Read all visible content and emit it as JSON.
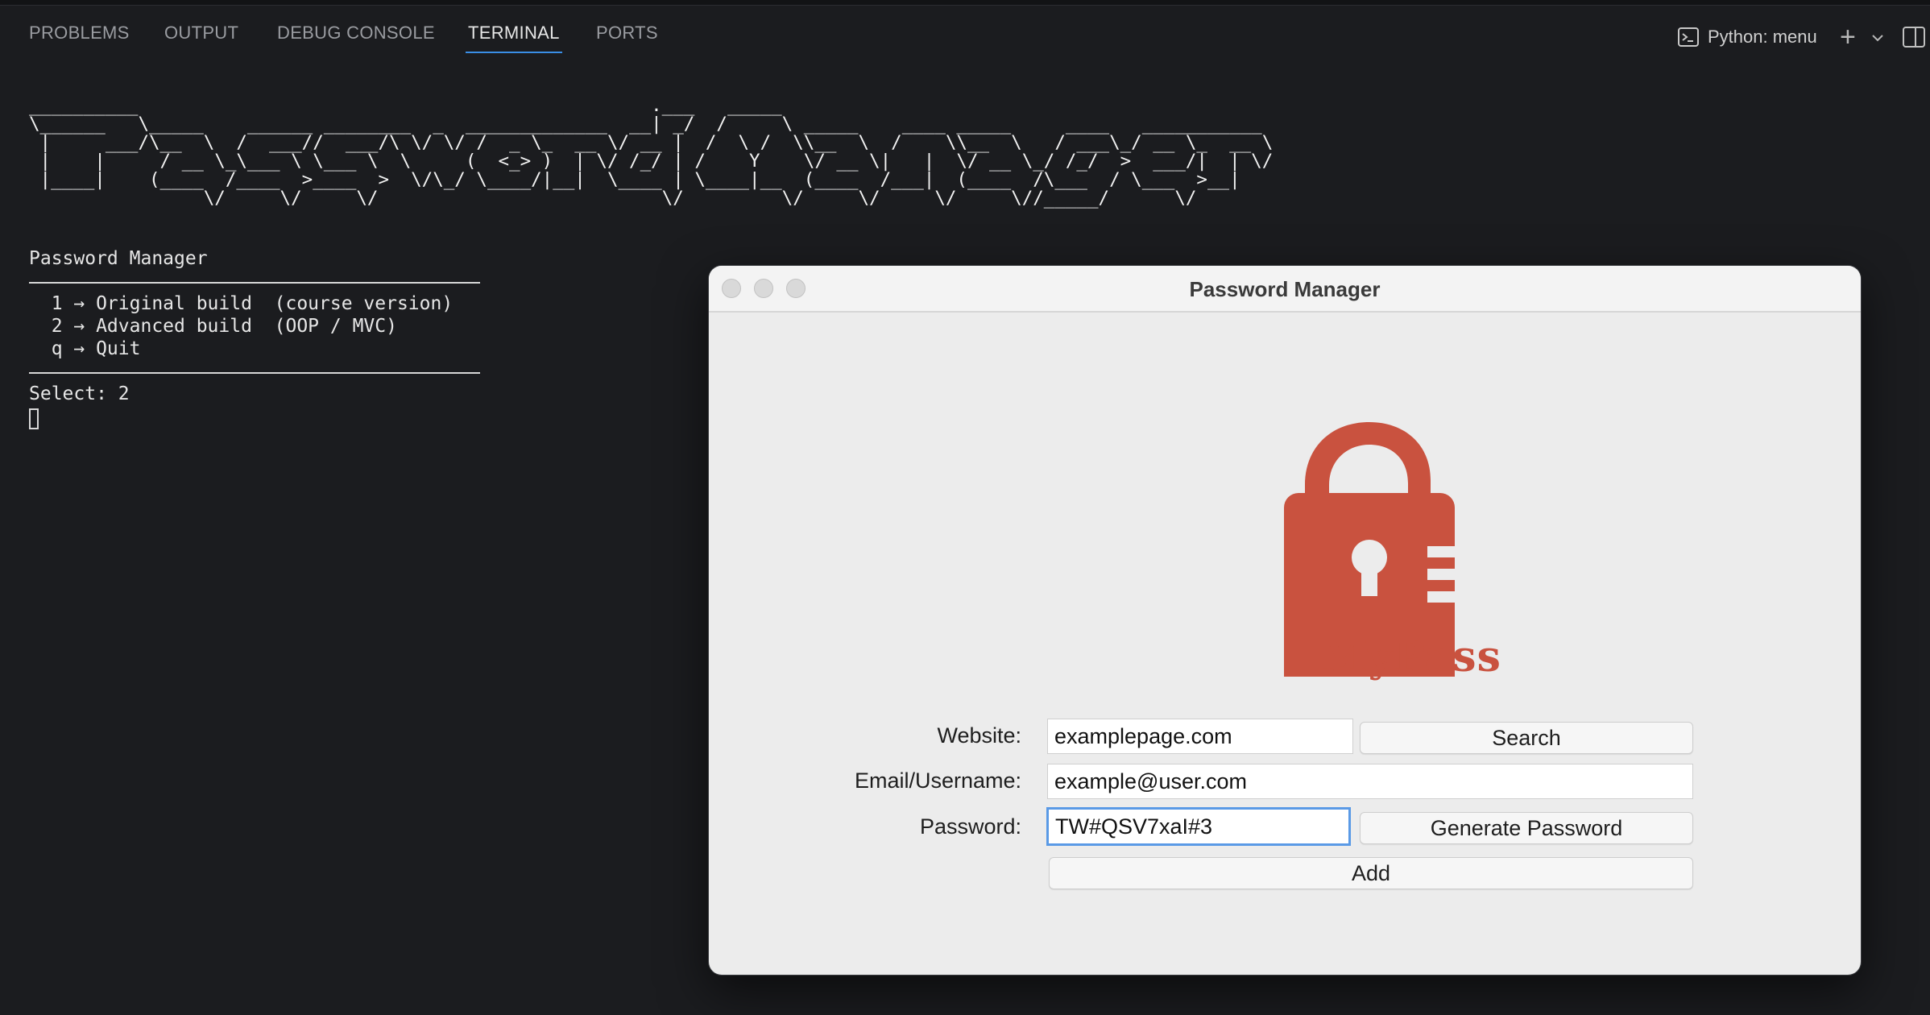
{
  "panel": {
    "tabs": [
      "PROBLEMS",
      "OUTPUT",
      "DEBUG CONSOLE",
      "TERMINAL",
      "PORTS"
    ],
    "active_tab": "TERMINAL",
    "terminal_selector": "Python: menu"
  },
  "terminal": {
    "banner_ascii": "__________                                               .___   _____\n\\______   \\_____    ______ ________  _  _____________  __| _/  /     \\ _____    ____ _____     ____   ___________\n |     ___/\\__  \\  /  ___//  ___/\\ \\/ \\/ /  _ \\_  __ \\/ __ |  /  \\ /  \\\\__  \\  /    \\\\__  \\   / ___\\_/ __ \\_  __ \\\n |    |     / __ \\_\\___ \\ \\___ \\  \\     (  <_> )  | \\/ /_/ | /    Y    \\/ __ \\|   |  \\/ __ \\_/ /_/  >  ___/|  | \\/\n |____|    (____  /____  >____  >  \\/\\_/ \\____/|__|  \\____ | \\____|__  (____  /___|  (____  /\\___  / \\___  >__|\n                \\/     \\/     \\/                          \\/         \\/     \\/     \\/     \\//_____/      \\/",
    "menu_title": "Password Manager",
    "option_1": "  1 → Original build  (course version)",
    "option_2": "  2 → Advanced build  (OOP / MVC)",
    "option_q": "  q → Quit",
    "prompt": "Select: 2"
  },
  "app": {
    "window_title": "Password Manager",
    "logo_text": "MyPass",
    "logo_color": "#c9523f",
    "website_label": "Website:",
    "website_value": "examplepage.com",
    "email_label": "Email/Username:",
    "email_value": "example@user.com",
    "password_label": "Password:",
    "password_value": "TW#QSV7xaI#3",
    "search_button": "Search",
    "generate_button": "Generate Password",
    "add_button": "Add"
  }
}
